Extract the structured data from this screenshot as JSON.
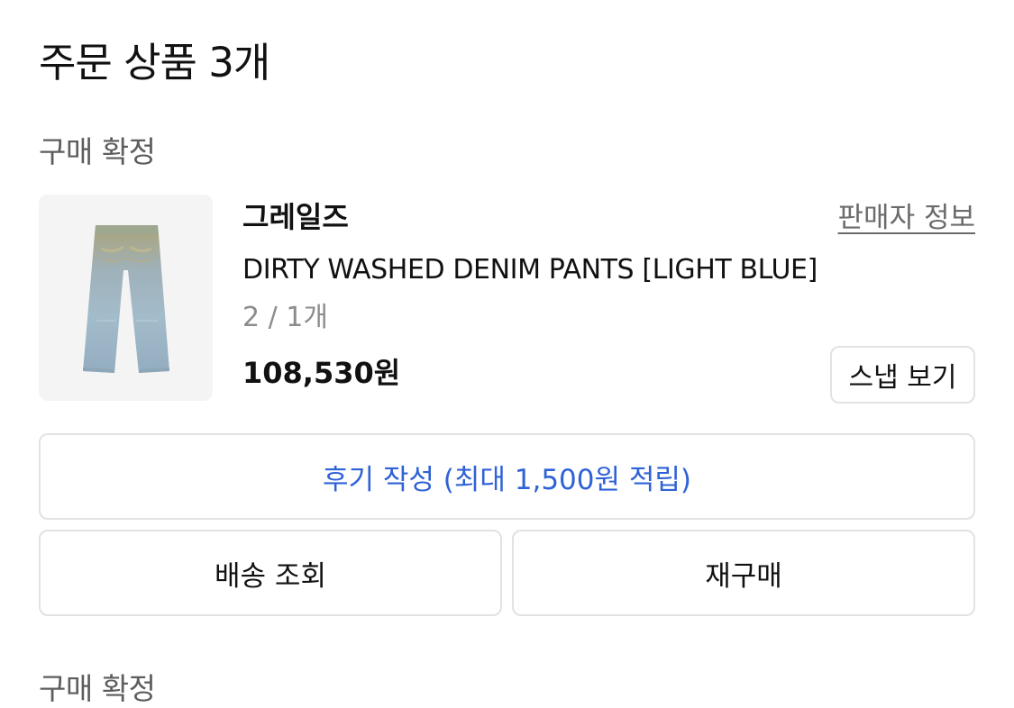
{
  "order": {
    "title": "주문 상품 3개"
  },
  "item": {
    "status": "구매 확정",
    "image": {
      "icon": "denim-pants-image"
    },
    "brand": "그레일즈",
    "seller_info_label": "판매자 정보",
    "name": "DIRTY WASHED DENIM PANTS [LIGHT BLUE]",
    "option": "2 / 1개",
    "price": "108,530원",
    "snap_label": "스냅 보기"
  },
  "actions": {
    "review_label": "후기 작성 (최대 1,500원 적립)",
    "delivery_label": "배송 조회",
    "rebuy_label": "재구매"
  },
  "next_item": {
    "status": "구매 확정"
  },
  "colors": {
    "accent_blue": "#2f62d6",
    "muted_text": "#8c8c8c",
    "border": "#e2e2e2",
    "thumb_bg": "#f4f4f4"
  }
}
